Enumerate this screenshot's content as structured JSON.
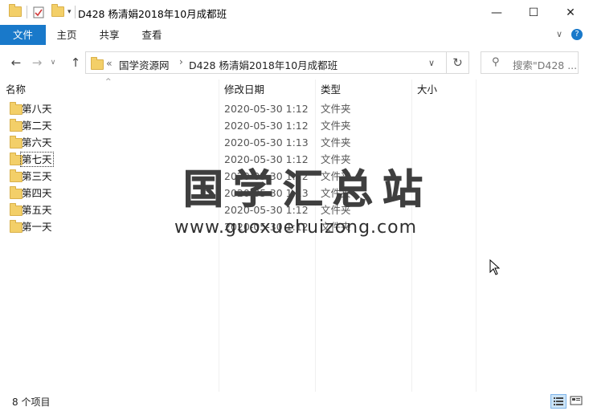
{
  "window": {
    "title": "D428 杨清娟2018年10月成都班",
    "minimize": "—",
    "maximize": "☐",
    "close": "✕"
  },
  "ribbon": {
    "tabs": [
      "文件",
      "主页",
      "共享",
      "查看"
    ],
    "expand_icon": "chevron-down-icon",
    "help_icon": "help-icon"
  },
  "nav": {
    "back_icon": "←",
    "forward_icon": "→",
    "recent_icon": "∨",
    "up_icon": "↑",
    "path_prefix": "«",
    "breadcrumbs": [
      "国学资源网",
      "D428 杨清娟2018年10月成都班"
    ],
    "refresh_icon": "↻",
    "search_placeholder": "搜索\"D428 ..."
  },
  "columns": {
    "name": "名称",
    "date": "修改日期",
    "type": "类型",
    "size": "大小"
  },
  "rows": [
    {
      "name": "第八天",
      "date": "2020-05-30 1:12",
      "type": "文件夹"
    },
    {
      "name": "第二天",
      "date": "2020-05-30 1:12",
      "type": "文件夹"
    },
    {
      "name": "第六天",
      "date": "2020-05-30 1:13",
      "type": "文件夹"
    },
    {
      "name": "第七天",
      "date": "2020-05-30 1:12",
      "type": "文件夹"
    },
    {
      "name": "第三天",
      "date": "2020-05-30 1:12",
      "type": "文件夹"
    },
    {
      "name": "第四天",
      "date": "2020-05-30 1:13",
      "type": "文件夹"
    },
    {
      "name": "第五天",
      "date": "2020-05-30 1:12",
      "type": "文件夹"
    },
    {
      "name": "第一天",
      "date": "2020-05-30 1:12",
      "type": "文件夹"
    }
  ],
  "watermark": {
    "chinese": "国学汇总站",
    "url": "www.guoxuehuizong.com"
  },
  "status": {
    "item_count": "8 个项目"
  },
  "colors": {
    "file_tab": "#1979ca",
    "folder": "#f3cf68"
  }
}
